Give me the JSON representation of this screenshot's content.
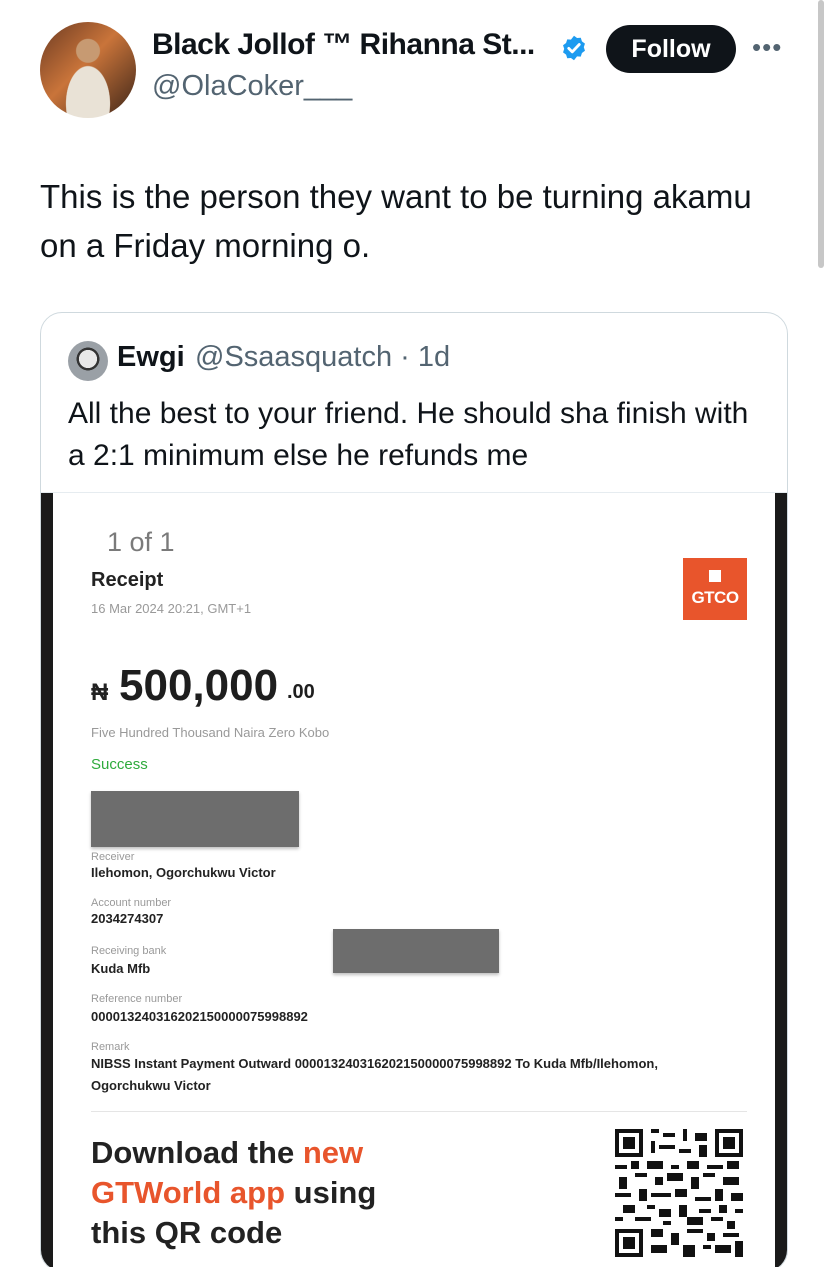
{
  "author": {
    "display_name": "Black Jollof ™ Rihanna St...",
    "handle": "@OlaCoker___",
    "follow_label": "Follow",
    "more_label": "•••"
  },
  "tweet": {
    "text": "This is the person they want to be turning akamu on a Friday morning o."
  },
  "quoted": {
    "name": "Ewgi",
    "handle_time": "@Ssaasquatch · 1d",
    "text": "All the best to your friend. He should sha finish with a 2:1 minimum else he refunds me"
  },
  "receipt": {
    "pager": "1 of 1",
    "title": "Receipt",
    "date": "16 Mar 2024 20:21, GMT+1",
    "bank_logo": "GTCO",
    "currency_symbol": "₦",
    "amount": "500,000",
    "kobo": ".00",
    "amount_words": "Five Hundred Thousand Naira Zero Kobo",
    "status": "Success",
    "receiver_label": "Receiver",
    "receiver_value": "Ilehomon, Ogorchukwu Victor",
    "account_label": "Account number",
    "account_value": "2034274307",
    "bank_label": "Receiving bank",
    "bank_value": "Kuda Mfb",
    "reference_label": "Reference number",
    "reference_value": "000013240316202150000075998892",
    "remark_label": "Remark",
    "remark_value": "NIBSS Instant Payment Outward 000013240316202150000075998892 To Kuda Mfb/Ilehomon, Ogorchukwu Victor",
    "promo_part1": "Download the ",
    "promo_accent1": "new",
    "promo_accent2": "GTWorld app",
    "promo_part2": " using",
    "promo_part3": "this QR code"
  },
  "colors": {
    "verified": "#1d9bf0",
    "gtco_orange": "#e8552c",
    "success": "#2eaa3c"
  }
}
